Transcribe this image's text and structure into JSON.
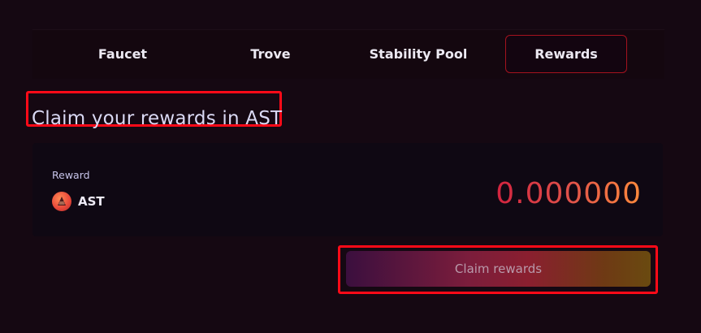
{
  "tabs": [
    {
      "label": "Faucet",
      "active": false
    },
    {
      "label": "Trove",
      "active": false
    },
    {
      "label": "Stability Pool",
      "active": false
    },
    {
      "label": "Rewards",
      "active": true
    }
  ],
  "page": {
    "title": "Claim your rewards in AST"
  },
  "reward_card": {
    "label": "Reward",
    "token": "AST",
    "token_icon": "ast-token-icon",
    "value": "0.000000"
  },
  "claim_button": {
    "label": "Claim rewards"
  },
  "colors": {
    "background": "#150812",
    "accent_red": "#a4121e",
    "highlight": "#ff0a18",
    "value_gradient_start": "#d2233f",
    "value_gradient_end": "#ff8a3c"
  }
}
